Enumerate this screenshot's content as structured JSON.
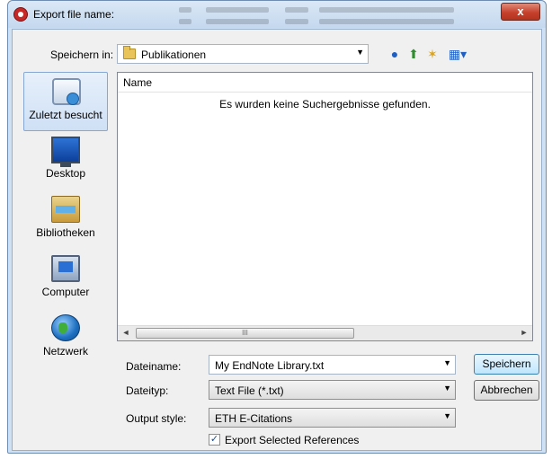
{
  "window": {
    "title": "Export file name:",
    "close_glyph": "x"
  },
  "toolbar": {
    "save_in_label": "Speichern in:",
    "save_in_value": "Publikationen",
    "icons": [
      "back-icon",
      "up-folder-icon",
      "new-folder-icon",
      "views-menu-icon"
    ]
  },
  "places": [
    {
      "label": "Zuletzt besucht",
      "icon": "recent-places-icon",
      "selected": true
    },
    {
      "label": "Desktop",
      "icon": "desktop-icon",
      "selected": false
    },
    {
      "label": "Bibliotheken",
      "icon": "libraries-icon",
      "selected": false
    },
    {
      "label": "Computer",
      "icon": "computer-icon",
      "selected": false
    },
    {
      "label": "Netzwerk",
      "icon": "network-icon",
      "selected": false
    }
  ],
  "file_list": {
    "column_name": "Name",
    "empty_message": "Es wurden keine Suchergebnisse gefunden.",
    "scroll_thumb_grip": "III"
  },
  "form": {
    "filename_label": "Dateiname:",
    "filename_value": "My EndNote Library.txt",
    "filetype_label": "Dateityp:",
    "filetype_value": "Text File (*.txt)",
    "output_style_label": "Output style:",
    "output_style_value": "ETH E-Citations",
    "export_selected_label": "Export Selected References",
    "export_selected_checked": true,
    "check_glyph": "✓"
  },
  "buttons": {
    "save": "Speichern",
    "cancel": "Abbrechen"
  },
  "glyphs": {
    "dropdown": "▼",
    "scroll_left": "◄",
    "scroll_right": "►"
  }
}
